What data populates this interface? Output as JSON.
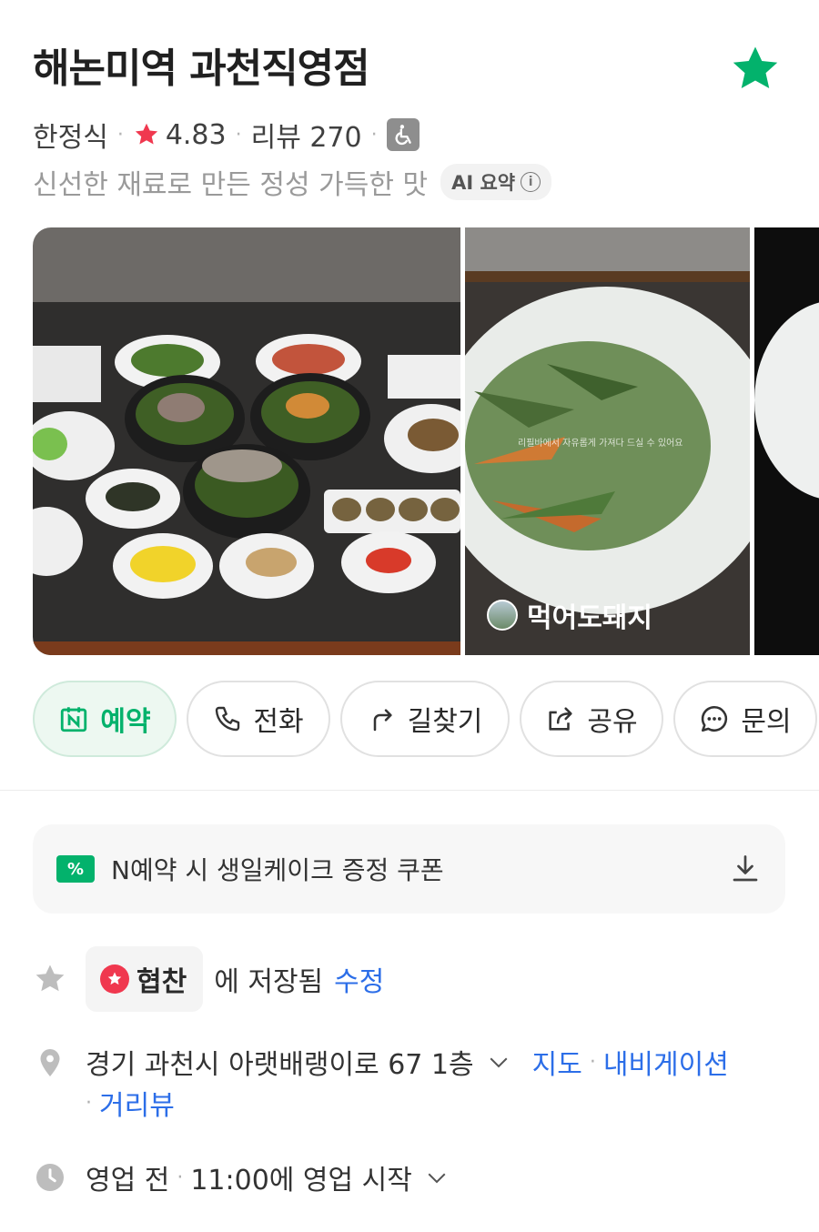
{
  "place": {
    "name": "해논미역 과천직영점",
    "category": "한정식",
    "rating": "4.83",
    "review_label": "리뷰 270",
    "summary": "신선한 재료로 만든 정성 가득한 맛",
    "ai_badge": "AI 요약",
    "ai_info": "i"
  },
  "gallery": {
    "photo2_caption": "먹어도돼지",
    "photo2_watermark": "리필바에서 자유롭게 가져다 드실 수 있어요"
  },
  "actions": [
    {
      "label": "예약",
      "icon": "naver-reserve-icon"
    },
    {
      "label": "전화",
      "icon": "phone-icon"
    },
    {
      "label": "길찾기",
      "icon": "directions-icon"
    },
    {
      "label": "공유",
      "icon": "share-icon"
    },
    {
      "label": "문의",
      "icon": "chat-icon"
    }
  ],
  "coupon": {
    "icon_text": "%",
    "text": "N예약 시 생일케이크 증정 쿠폰"
  },
  "saved": {
    "list_name": "협찬",
    "suffix": "에 저장됨",
    "edit_link": "수정"
  },
  "address": {
    "text": "경기 과천시 아랫배랭이로 67 1층",
    "map_link": "지도",
    "nav_link": "내비게이션",
    "street_link": "거리뷰"
  },
  "hours": {
    "status": "영업 전",
    "detail": "11:00에 영업 시작"
  },
  "colors": {
    "brand_green": "#03b26c",
    "rating_star": "#f0384f",
    "link_blue": "#2c6ee8"
  }
}
